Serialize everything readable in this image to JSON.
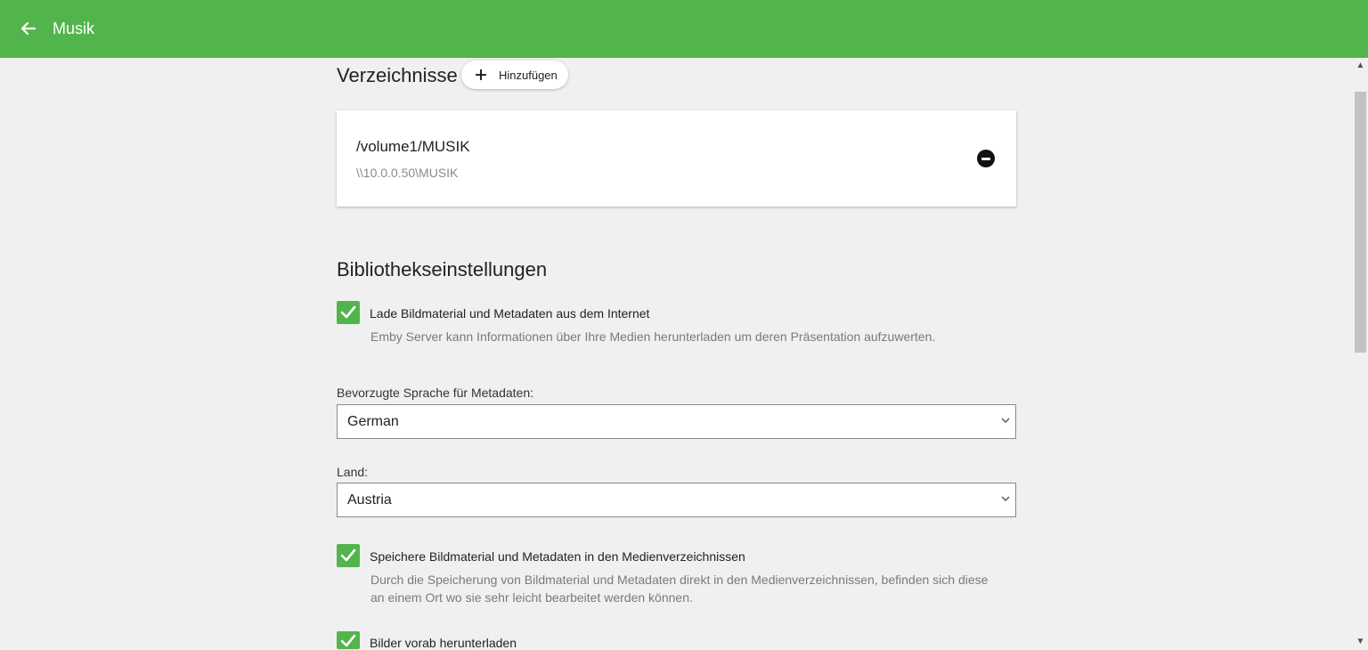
{
  "header": {
    "back_icon": "arrow-left-icon",
    "title": "Musik",
    "background": "#52b54b"
  },
  "folders": {
    "title": "Verzeichnisse",
    "add_label": "Hinzufügen",
    "items": [
      {
        "path": "/volume1/MUSIK",
        "network_path": "\\\\10.0.0.50\\MUSIK"
      }
    ]
  },
  "library_settings": {
    "title": "Bibliothekseinstellungen",
    "download_metadata": {
      "checked": true,
      "label": "Lade Bildmaterial und Metadaten aus dem Internet",
      "description": "Emby Server kann Informationen über Ihre Medien herunterladen um deren Präsentation aufzuwerten."
    },
    "metadata_language": {
      "label": "Bevorzugte Sprache für Metadaten:",
      "value": "German"
    },
    "country": {
      "label": "Land:",
      "value": "Austria"
    },
    "save_local": {
      "checked": true,
      "label": "Speichere Bildmaterial und Metadaten in den Medienverzeichnissen",
      "description": "Durch die Speicherung von Bildmaterial und Metadaten direkt in den Medienverzeichnissen, befinden sich diese an einem Ort wo sie sehr leicht bearbeitet werden können."
    },
    "download_images_advance": {
      "checked": true,
      "label": "Bilder vorab herunterladen"
    }
  }
}
